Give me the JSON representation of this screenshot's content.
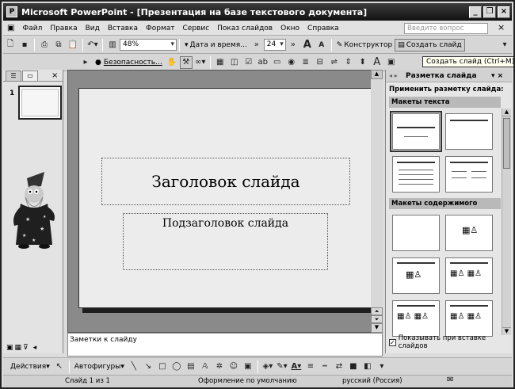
{
  "window": {
    "title": "Microsoft PowerPoint - [Презентация на базе текстового документа]",
    "min_glyph": "_",
    "max_glyph": "❐",
    "close_glyph": "×"
  },
  "menu": {
    "items": [
      "Файл",
      "Правка",
      "Вид",
      "Вставка",
      "Формат",
      "Сервис",
      "Показ слайдов",
      "Окно",
      "Справка"
    ],
    "help_placeholder": "Введите вопрос",
    "close_glyph": "×"
  },
  "toolbar1": {
    "zoom": "48%",
    "datetime_label": "Дата и время...",
    "font_size": "24",
    "designer_label": "Конструктор",
    "new_slide_label": "Создать слайд",
    "more_glyph": "»",
    "grow_glyph": "A",
    "shrink_glyph": "A"
  },
  "toolbar2": {
    "security_label": "Безопасность...",
    "more_glyph": "»"
  },
  "tooltip": "Создать слайд (Ctrl+M)",
  "left_pane": {
    "tab_outline_glyph": "☰",
    "tab_slides_glyph": "▭",
    "close_glyph": "×",
    "slide_number": "1"
  },
  "slide": {
    "title_placeholder": "Заголовок слайда",
    "subtitle_placeholder": "Подзаголовок слайда"
  },
  "notes": {
    "placeholder": "Заметки к слайду"
  },
  "task_pane": {
    "title": "Разметка слайда",
    "subtitle": "Применить разметку слайда:",
    "section_text": "Макеты текста",
    "section_content": "Макеты содержимого",
    "checkbox_label": "Показывать при вставке слайдов",
    "checkbox_checked": true
  },
  "drawing_bar": {
    "actions_label": "Действия",
    "autoshapes_label": "Автофигуры"
  },
  "status_bar": {
    "slide": "Слайд 1 из 1",
    "design": "Оформление по умолчанию",
    "language": "русский (Россия)"
  }
}
